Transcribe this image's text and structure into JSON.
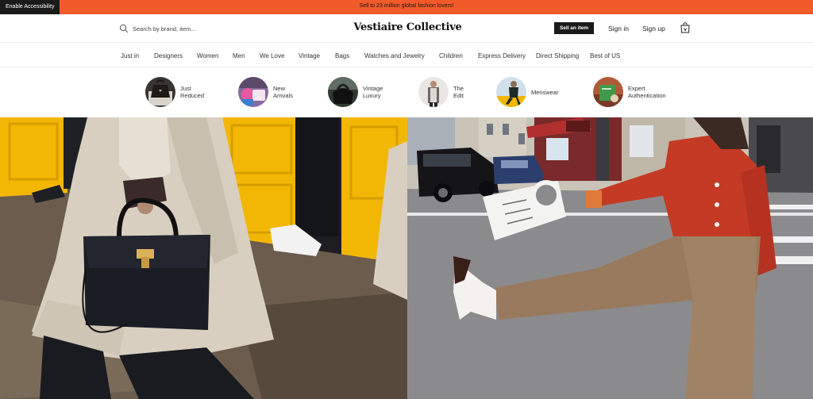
{
  "promo": {
    "accessibility_label": "Enable Accessibility",
    "message": "Sell to 23 million global fashion lovers!"
  },
  "header": {
    "search_placeholder": "Search by brand, item...",
    "logo": "Vestiaire Collective",
    "sell_label": "Sell an item",
    "signin_label": "Sign in",
    "signup_label": "Sign up"
  },
  "nav": {
    "items": [
      {
        "label": "Just in"
      },
      {
        "label": "Designers"
      },
      {
        "label": "Women"
      },
      {
        "label": "Men"
      },
      {
        "label": "We Love"
      },
      {
        "label": "Vintage"
      },
      {
        "label": "Bags"
      },
      {
        "label": "Watches and Jewelry"
      },
      {
        "label": "Children"
      },
      {
        "label": "Express Delivery"
      },
      {
        "label": "Direct Shipping"
      },
      {
        "label": "Best of US"
      }
    ]
  },
  "shortcuts": [
    {
      "line1": "Just",
      "line2": "Reduced"
    },
    {
      "line1": "New",
      "line2": "Arrivals"
    },
    {
      "line1": "Vintage",
      "line2": "Luxury"
    },
    {
      "line1": "The",
      "line2": "Edit"
    },
    {
      "line1": "Menswear",
      "line2": ""
    },
    {
      "line1": "Expert",
      "line2": "Authentication"
    }
  ],
  "colors": {
    "promo": "#f15a29",
    "dark": "#1a1a1a",
    "accent_yellow": "#f2b705"
  }
}
